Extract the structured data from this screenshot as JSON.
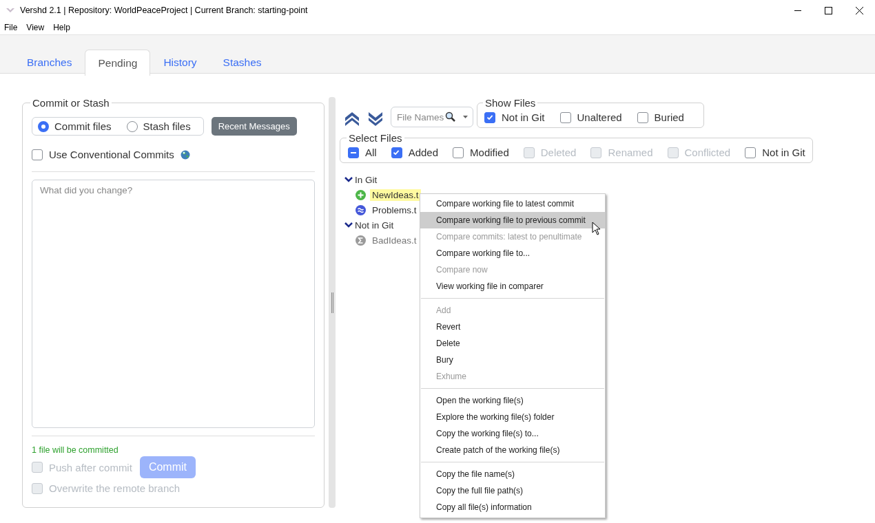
{
  "window": {
    "title": "Vershd 2.1 | Repository: WorldPeaceProject | Current Branch: starting-point"
  },
  "menu": [
    "File",
    "View",
    "Help"
  ],
  "tabs": [
    {
      "label": "Branches",
      "selected": false
    },
    {
      "label": "Pending",
      "selected": true
    },
    {
      "label": "History",
      "selected": false
    },
    {
      "label": "Stashes",
      "selected": false
    }
  ],
  "commit_panel": {
    "legend": "Commit or Stash",
    "modes": [
      {
        "label": "Commit files",
        "selected": true
      },
      {
        "label": "Stash files",
        "selected": false
      }
    ],
    "recent_button": "Recent Messages",
    "conventional": {
      "label": "Use Conventional Commits",
      "checked": false
    },
    "message": {
      "placeholder": "What did you change?"
    },
    "summary": "1 file will be committed",
    "push": {
      "label": "Push after commit",
      "checked": false,
      "disabled": true
    },
    "commit_button": {
      "label": "Commit",
      "disabled": true
    },
    "overwrite": {
      "label": "Overwrite the remote branch",
      "checked": false,
      "disabled": true
    }
  },
  "files_panel": {
    "filter": {
      "placeholder": "File Names"
    },
    "show_files": {
      "legend": "Show Files",
      "options": [
        {
          "label": "Not in Git",
          "checked": true,
          "disabled": false
        },
        {
          "label": "Unaltered",
          "checked": false,
          "disabled": false
        },
        {
          "label": "Buried",
          "checked": false,
          "disabled": false
        }
      ]
    },
    "select_files": {
      "legend": "Select Files",
      "options": [
        {
          "label": "All",
          "checked": true,
          "mixed": true,
          "disabled": false
        },
        {
          "label": "Added",
          "checked": true,
          "disabled": false
        },
        {
          "label": "Modified",
          "checked": false,
          "disabled": false
        },
        {
          "label": "Deleted",
          "checked": false,
          "disabled": true
        },
        {
          "label": "Renamed",
          "checked": false,
          "disabled": true
        },
        {
          "label": "Conflicted",
          "checked": false,
          "disabled": true
        },
        {
          "label": "Not in Git",
          "checked": false,
          "disabled": false
        }
      ]
    },
    "tree": [
      {
        "label": "In Git",
        "expanded": true,
        "children": [
          {
            "label": "NewIdeas.t",
            "kind": "added",
            "selected": true
          },
          {
            "label": "Problems.t",
            "kind": "modified",
            "selected": false
          }
        ]
      },
      {
        "label": "Not in Git",
        "expanded": true,
        "children": [
          {
            "label": "BadIdeas.t",
            "kind": "untracked",
            "selected": false
          }
        ]
      }
    ]
  },
  "context_menu": {
    "groups": [
      [
        {
          "label": "Compare working file to latest commit",
          "disabled": false,
          "selected": false
        },
        {
          "label": "Compare working file to previous commit",
          "disabled": false,
          "selected": true
        },
        {
          "label": "Compare commits: latest to penultimate",
          "disabled": true,
          "selected": false
        },
        {
          "label": "Compare working file to...",
          "disabled": false,
          "selected": false
        },
        {
          "label": "Compare now",
          "disabled": true,
          "selected": false
        },
        {
          "label": "View working file in comparer",
          "disabled": false,
          "selected": false
        }
      ],
      [
        {
          "label": "Add",
          "disabled": true,
          "selected": false
        },
        {
          "label": "Revert",
          "disabled": false,
          "selected": false
        },
        {
          "label": "Delete",
          "disabled": false,
          "selected": false
        },
        {
          "label": "Bury",
          "disabled": false,
          "selected": false
        },
        {
          "label": "Exhume",
          "disabled": true,
          "selected": false
        }
      ],
      [
        {
          "label": "Open the working file(s)",
          "disabled": false,
          "selected": false
        },
        {
          "label": "Explore the working file(s) folder",
          "disabled": false,
          "selected": false
        },
        {
          "label": "Copy the working file(s) to...",
          "disabled": false,
          "selected": false
        },
        {
          "label": "Create patch of the working file(s)",
          "disabled": false,
          "selected": false
        }
      ],
      [
        {
          "label": "Copy the file name(s)",
          "disabled": false,
          "selected": false
        },
        {
          "label": "Copy the full file path(s)",
          "disabled": false,
          "selected": false
        },
        {
          "label": "Copy all file(s) information",
          "disabled": false,
          "selected": false
        }
      ]
    ]
  }
}
